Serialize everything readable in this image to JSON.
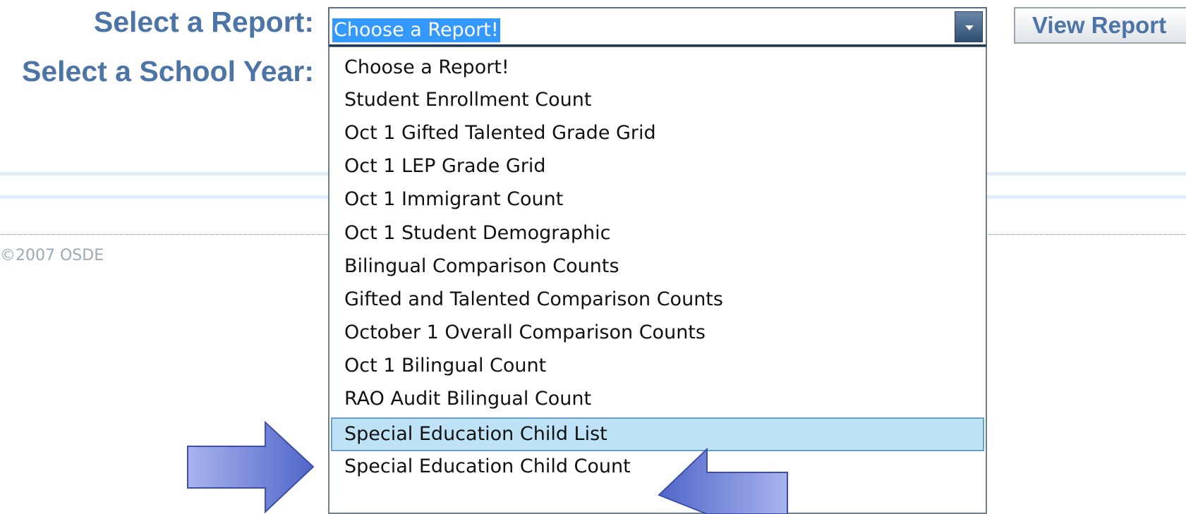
{
  "form": {
    "report_label": "Select a Report:",
    "year_label": "Select a School Year:",
    "selected_report": "Choose a Report!",
    "view_button": "View Report"
  },
  "footer": {
    "copyright": "©2007 OSDE"
  },
  "dropdown": {
    "options": [
      "Choose a Report!",
      "Student Enrollment Count",
      "Oct 1 Gifted Talented Grade Grid",
      "Oct 1 LEP Grade Grid",
      "Oct 1 Immigrant Count",
      "Oct 1 Student Demographic",
      "Bilingual Comparison Counts",
      "Gifted and Talented Comparison Counts",
      "October 1 Overall Comparison Counts",
      "Oct 1 Bilingual Count",
      "RAO Audit Bilingual Count",
      "Special Education Child List",
      "Special Education Child Count"
    ],
    "highlighted": "Special Education Child List"
  },
  "colors": {
    "label": "#4c74a6",
    "selection": "#3399ff",
    "highlight": "#bfe3f6",
    "annotation_arrow": "#7f93df"
  },
  "icons": {
    "select_toggle": "chevron-down-icon",
    "annotations": [
      "arrow-right-icon",
      "arrow-left-icon"
    ]
  }
}
